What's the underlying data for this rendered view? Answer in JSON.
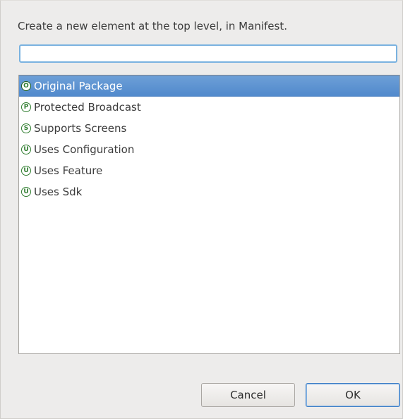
{
  "dialog": {
    "prompt": "Create a new element at the top level, in Manifest.",
    "filter": {
      "value": "",
      "placeholder": ""
    },
    "items": [
      {
        "badge": "O",
        "label": "Original Package",
        "selected": true
      },
      {
        "badge": "P",
        "label": "Protected Broadcast",
        "selected": false
      },
      {
        "badge": "S",
        "label": "Supports Screens",
        "selected": false
      },
      {
        "badge": "U",
        "label": "Uses Configuration",
        "selected": false
      },
      {
        "badge": "U",
        "label": "Uses Feature",
        "selected": false
      },
      {
        "badge": "U",
        "label": "Uses Sdk",
        "selected": false
      }
    ],
    "buttons": {
      "cancel": "Cancel",
      "ok": "OK"
    }
  },
  "colors": {
    "selection": "#5a92d0",
    "badge_green": "#2f7d2f",
    "dialog_bg": "#edeceb"
  }
}
